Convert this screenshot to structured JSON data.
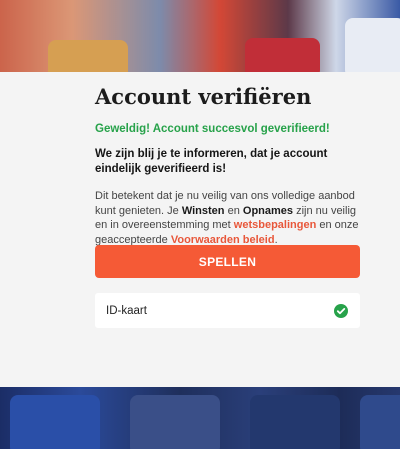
{
  "modal": {
    "title": "Account verifiëren",
    "success_message": "Geweldig! Account succesvol geverifieerd!",
    "intro": "We zijn blij je te informeren, dat je account eindelijk geverifieerd is!",
    "description": {
      "part1": "Dit betekent dat je nu veilig van ons volledige aanbod kunt genieten. Je ",
      "winsten": "Winsten",
      "part2": " en ",
      "opnames": "Opnames",
      "part3": " zijn nu veilig en in overeenstemming met ",
      "link_terms": "wetsbepalingen",
      "part4": " en onze geaccepteerde ",
      "link_conditions": "Voorwaarden beleid",
      "part5": "."
    },
    "play_button_label": "SPELLEN",
    "verified_documents": [
      {
        "label": "ID-kaart",
        "status_icon": "check-circle-icon"
      }
    ]
  },
  "colors": {
    "accent": "#f55a36",
    "success": "#27a24a",
    "modal_bg": "#f4f4f4"
  }
}
